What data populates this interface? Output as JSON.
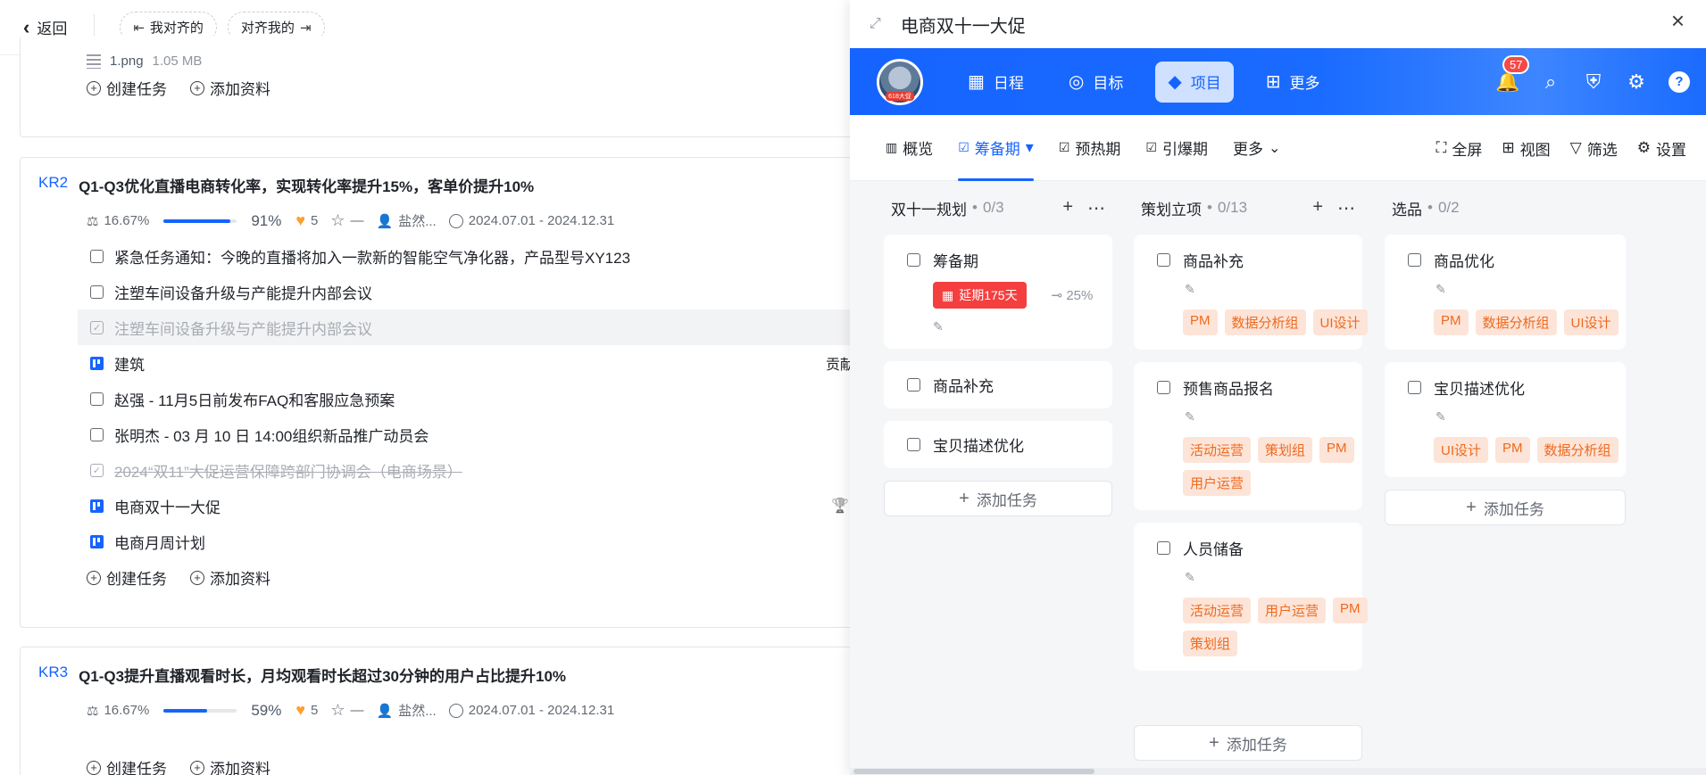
{
  "left": {
    "topbar": {
      "back_label": "返回",
      "aligned_mine": "我对齐的",
      "aligned_to_me": "对齐我的"
    },
    "card1": {
      "file_name": "1.png",
      "file_size": "1.05 MB",
      "create_task": "创建任务",
      "add_material": "添加资料"
    },
    "kr2": {
      "code": "KR2",
      "title": "Q1-Q3优化直播电商转化率，实现转化率提升15%，客单价提升10%",
      "weight": "16.67%",
      "progress_pct": "91%",
      "progress_value": 0.91,
      "likes": "5",
      "rating": "—",
      "owner": "盐然...",
      "date_range": "2024.07.01 - 2024.12.31",
      "tasks": [
        {
          "text": "紧急任务通知：今晚的直播将加入一款新的智能空气净化器，产品型号XY123",
          "kind": "todo"
        },
        {
          "text": "注塑车间设备升级与产能提升内部会议",
          "kind": "todo"
        },
        {
          "text": "注塑车间设备升级与产能提升内部会议",
          "kind": "done"
        },
        {
          "text": "建筑",
          "kind": "board",
          "side": "贡献值"
        },
        {
          "text": "赵强 - 11月5日前发布FAQ和客服应急预案",
          "kind": "todo"
        },
        {
          "text": "张明杰 - 03 月 10 日 14:00组织新品推广动员会",
          "kind": "todo"
        },
        {
          "text": "2024“双11”大促运营保障跨部门协调会（电商场景）",
          "kind": "strike"
        },
        {
          "text": "电商双十一大促",
          "kind": "board",
          "trophy": true
        },
        {
          "text": "电商月周计划",
          "kind": "board"
        }
      ],
      "create_task": "创建任务",
      "add_material": "添加资料"
    },
    "kr3": {
      "code": "KR3",
      "title": "Q1-Q3提升直播观看时长，月均观看时长超过30分钟的用户占比提升10%",
      "weight": "16.67%",
      "progress_pct": "59%",
      "progress_value": 0.59,
      "likes": "5",
      "rating": "—",
      "owner": "盐然...",
      "date_range": "2024.07.01 - 2024.12.31",
      "create_task": "创建任务",
      "add_material": "添加资料"
    }
  },
  "right": {
    "title": "电商双十一大促",
    "avatar_tag": "618大促",
    "nav": [
      {
        "label": "日程",
        "icon": "calendar-icon"
      },
      {
        "label": "目标",
        "icon": "target-icon"
      },
      {
        "label": "项目",
        "icon": "cube-icon",
        "active": true
      },
      {
        "label": "更多",
        "icon": "apps-icon"
      }
    ],
    "notif_count": "57",
    "subtabs": [
      {
        "label": "概览"
      },
      {
        "label": "筹备期",
        "active": true
      },
      {
        "label": "预热期"
      },
      {
        "label": "引爆期"
      },
      {
        "label": "更多"
      }
    ],
    "tools": [
      "全屏",
      "视图",
      "筛选",
      "设置"
    ],
    "columns": [
      {
        "name": "双十一规划",
        "count": "0/3",
        "cards": [
          {
            "title": "筹备期",
            "overdue": "延期175天",
            "subprogress": "25%"
          },
          {
            "title": "商品补充"
          },
          {
            "title": "宝贝描述优化"
          }
        ],
        "add_label": "添加任务"
      },
      {
        "name": "策划立项",
        "count": "0/13",
        "cards": [
          {
            "title": "商品补充",
            "tags": [
              "PM",
              "数据分析组",
              "UI设计"
            ]
          },
          {
            "title": "预售商品报名",
            "tags": [
              "活动运营",
              "策划组",
              "PM",
              "用户运营"
            ]
          },
          {
            "title": "人员储备",
            "tags": [
              "活动运营",
              "用户运营",
              "PM",
              "策划组"
            ]
          }
        ],
        "add_label": "添加任务"
      },
      {
        "name": "选品",
        "count": "0/2",
        "cards": [
          {
            "title": "商品优化",
            "tags": [
              "PM",
              "数据分析组",
              "UI设计"
            ]
          },
          {
            "title": "宝贝描述优化",
            "tags": [
              "UI设计",
              "PM",
              "数据分析组"
            ]
          }
        ],
        "add_label": "添加任务"
      }
    ]
  }
}
